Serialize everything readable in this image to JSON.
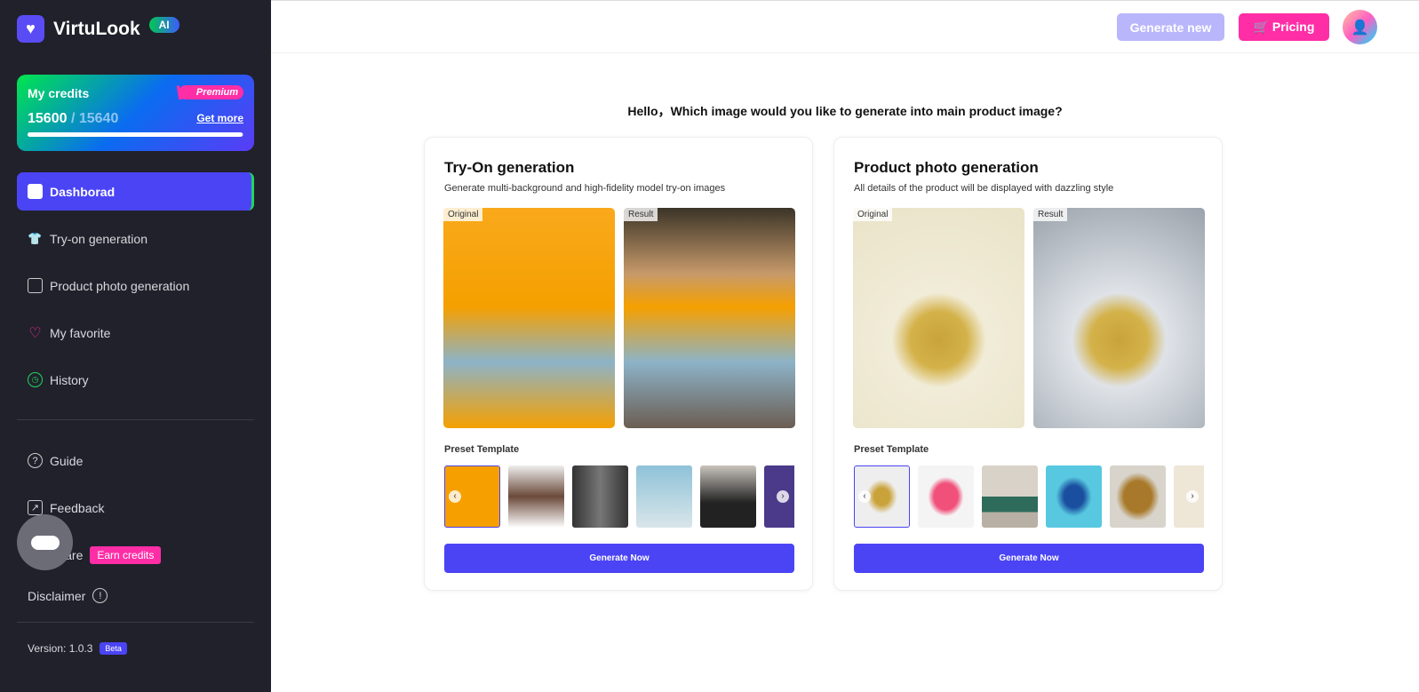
{
  "brand": {
    "name": "VirtuLook",
    "badge": "AI"
  },
  "credits": {
    "title": "My credits",
    "tier": "Premium",
    "used": "15600",
    "total": "/ 15640",
    "get_more": "Get more",
    "fill_percent": 99.7
  },
  "nav": [
    {
      "label": "Dashborad",
      "icon": "dashboard-icon",
      "active": true
    },
    {
      "label": "Try-on generation",
      "icon": "tshirt-icon"
    },
    {
      "label": "Product photo generation",
      "icon": "image-icon"
    },
    {
      "label": "My favorite",
      "icon": "heart-icon"
    },
    {
      "label": "History",
      "icon": "clock-icon"
    }
  ],
  "nav2": [
    {
      "label": "Guide",
      "icon": "help-icon"
    },
    {
      "label": "Feedback",
      "icon": "external-link-icon"
    },
    {
      "label": "Share",
      "icon": "share-icon",
      "badge": "Earn credits"
    },
    {
      "label": "Disclaimer",
      "icon": "info-icon"
    }
  ],
  "version": {
    "label": "Version: 1.0.3",
    "badge": "Beta"
  },
  "topbar": {
    "generate_new": "Generate new",
    "pricing": "Pricing"
  },
  "hello": "Hello，Which image would you like to generate into main product image?",
  "cards": [
    {
      "title": "Try-On generation",
      "subtitle": "Generate multi-background and high-fidelity model try-on images",
      "original": "Original",
      "result": "Result",
      "preset": "Preset Template",
      "button": "Generate Now"
    },
    {
      "title": "Product photo generation",
      "subtitle": "All details of the product will be displayed with dazzling style",
      "original": "Original",
      "result": "Result",
      "preset": "Preset Template",
      "button": "Generate Now"
    }
  ],
  "colors": {
    "accent": "#4b44f5",
    "pink": "#ff2ea6",
    "sidebar": "#21212b"
  }
}
